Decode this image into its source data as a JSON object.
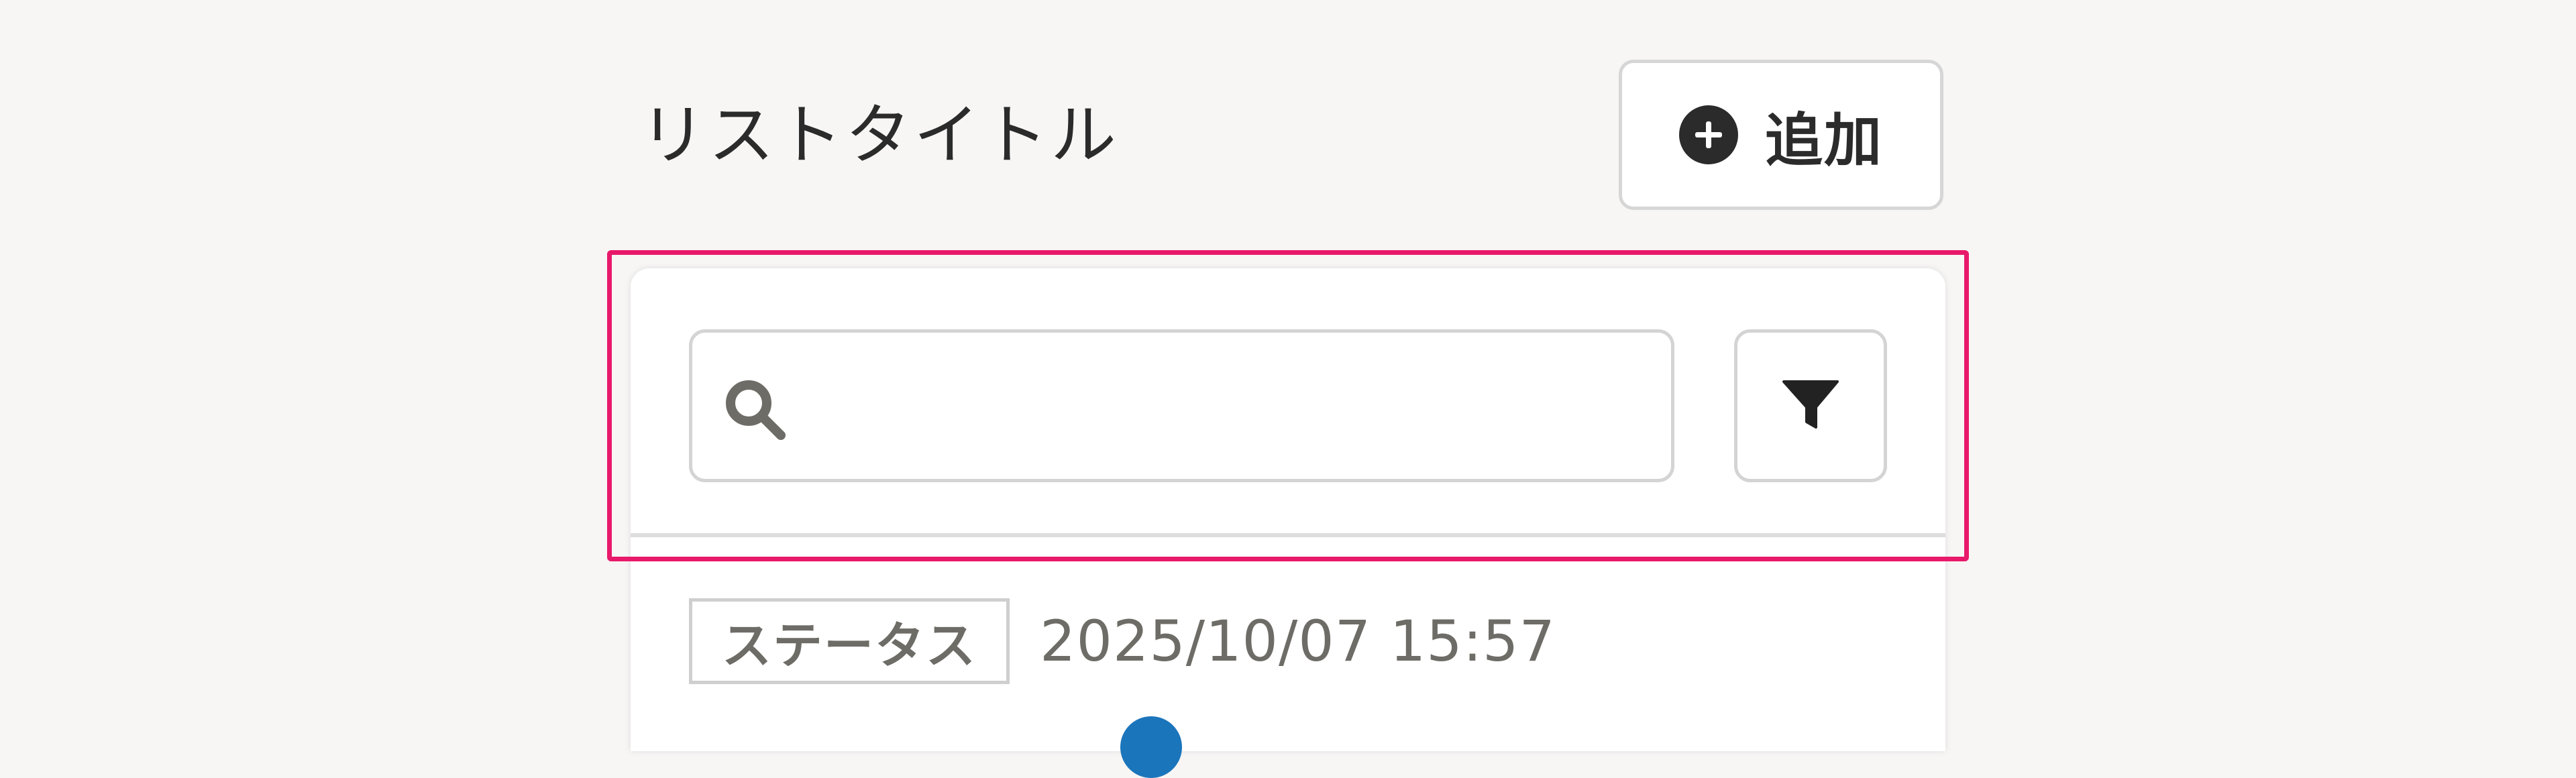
{
  "header": {
    "title": "リストタイトル",
    "add_button_label": "追加",
    "add_icon": "plus-circle-icon"
  },
  "search": {
    "value": "",
    "placeholder": "",
    "icon": "search-icon"
  },
  "filter": {
    "icon": "funnel-icon"
  },
  "list": {
    "items": [
      {
        "status": "ステータス",
        "timestamp": "2025/10/07 15:57"
      }
    ]
  },
  "colors": {
    "background": "#f7f6f5",
    "highlight": "#e8196a",
    "text_primary": "#2b2b2b",
    "text_muted": "#6e6c66",
    "border": "#d4d4d4",
    "accent_blue": "#1b75bb"
  }
}
